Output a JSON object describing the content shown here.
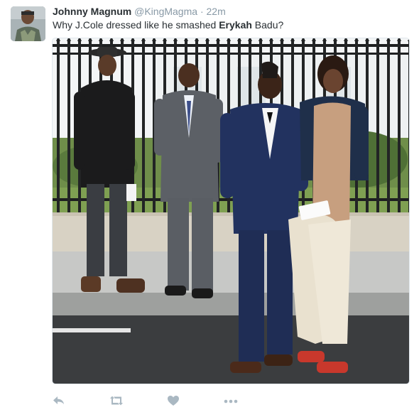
{
  "tweet": {
    "display_name": "Johnny Magnum",
    "handle": "@KingMagma",
    "separator": "·",
    "timestamp": "22m",
    "text_before": "Why J.Cole dressed like he smashed ",
    "text_bold": "Erykah",
    "text_after": " Badu?"
  },
  "actions": {
    "reply_icon": "reply-icon",
    "retweet_icon": "retweet-icon",
    "like_icon": "heart-icon",
    "more_icon": "more-icon"
  },
  "colors": {
    "name": "#292f33",
    "muted": "#8899a6",
    "action_icon": "#aab8c2"
  }
}
